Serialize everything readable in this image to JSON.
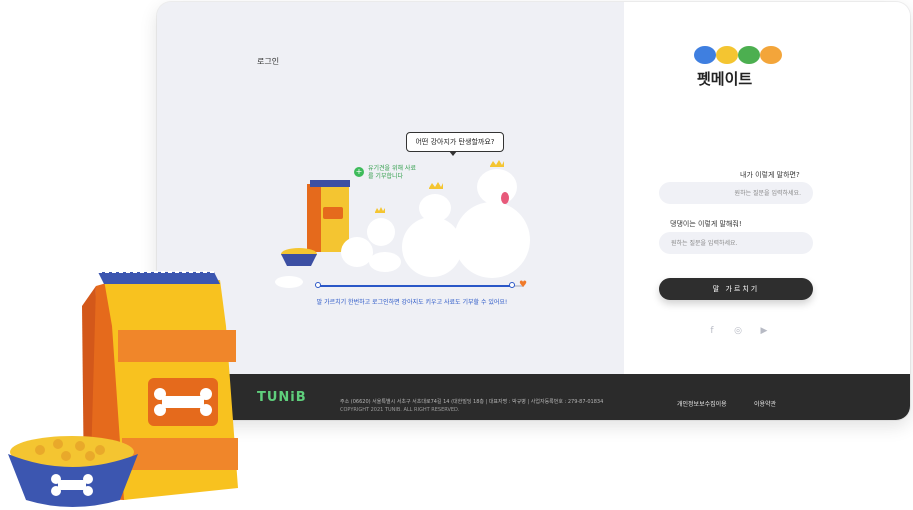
{
  "header": {
    "login_link": "로그인"
  },
  "hero": {
    "speech_bubble": "어떤 강아지가 탄생할까요?",
    "donate_note": "유기견을 위해 사료를 기부합니다",
    "progress": 0.94,
    "progress_caption": "말 가르치기 한번하고 로그인하면 강아지도 키우고 사료도 기부할 수 있어요!"
  },
  "brand": {
    "name": "펫메이트"
  },
  "form": {
    "q1_label": "내가 이렇게 말하면?",
    "q1_placeholder": "원하는 질문을 입력하세요.",
    "q2_label": "댕댕이는 이렇게 말해줘!",
    "q2_placeholder": "원하는 질문을 입력하세요.",
    "submit_label": "말 가르치기"
  },
  "socials": [
    {
      "name": "facebook",
      "glyph": "f"
    },
    {
      "name": "instagram",
      "glyph": "◎"
    },
    {
      "name": "youtube",
      "glyph": "▶"
    }
  ],
  "footer": {
    "logo": "TUNiB",
    "address": "주소 (06620) 서울특별시 서초구 서초대로74길 14 (대한빌딩 18층 | 대표자명 : 박규병 | 사업자등록번호 : 279-87-01834",
    "copyright": "COPYRIGHT 2021 TUNIB. ALL RIGHT RESERVED.",
    "privacy": "개인정보보수집이용",
    "terms": "이용약관"
  },
  "colors": {
    "accent_green": "#3dbb5a",
    "accent_blue": "#2a57c7",
    "footer_bg": "#2b2b2b",
    "badge_colors": [
      "#3f7fe0",
      "#f4c531",
      "#4caf50",
      "#f3a53a"
    ]
  }
}
